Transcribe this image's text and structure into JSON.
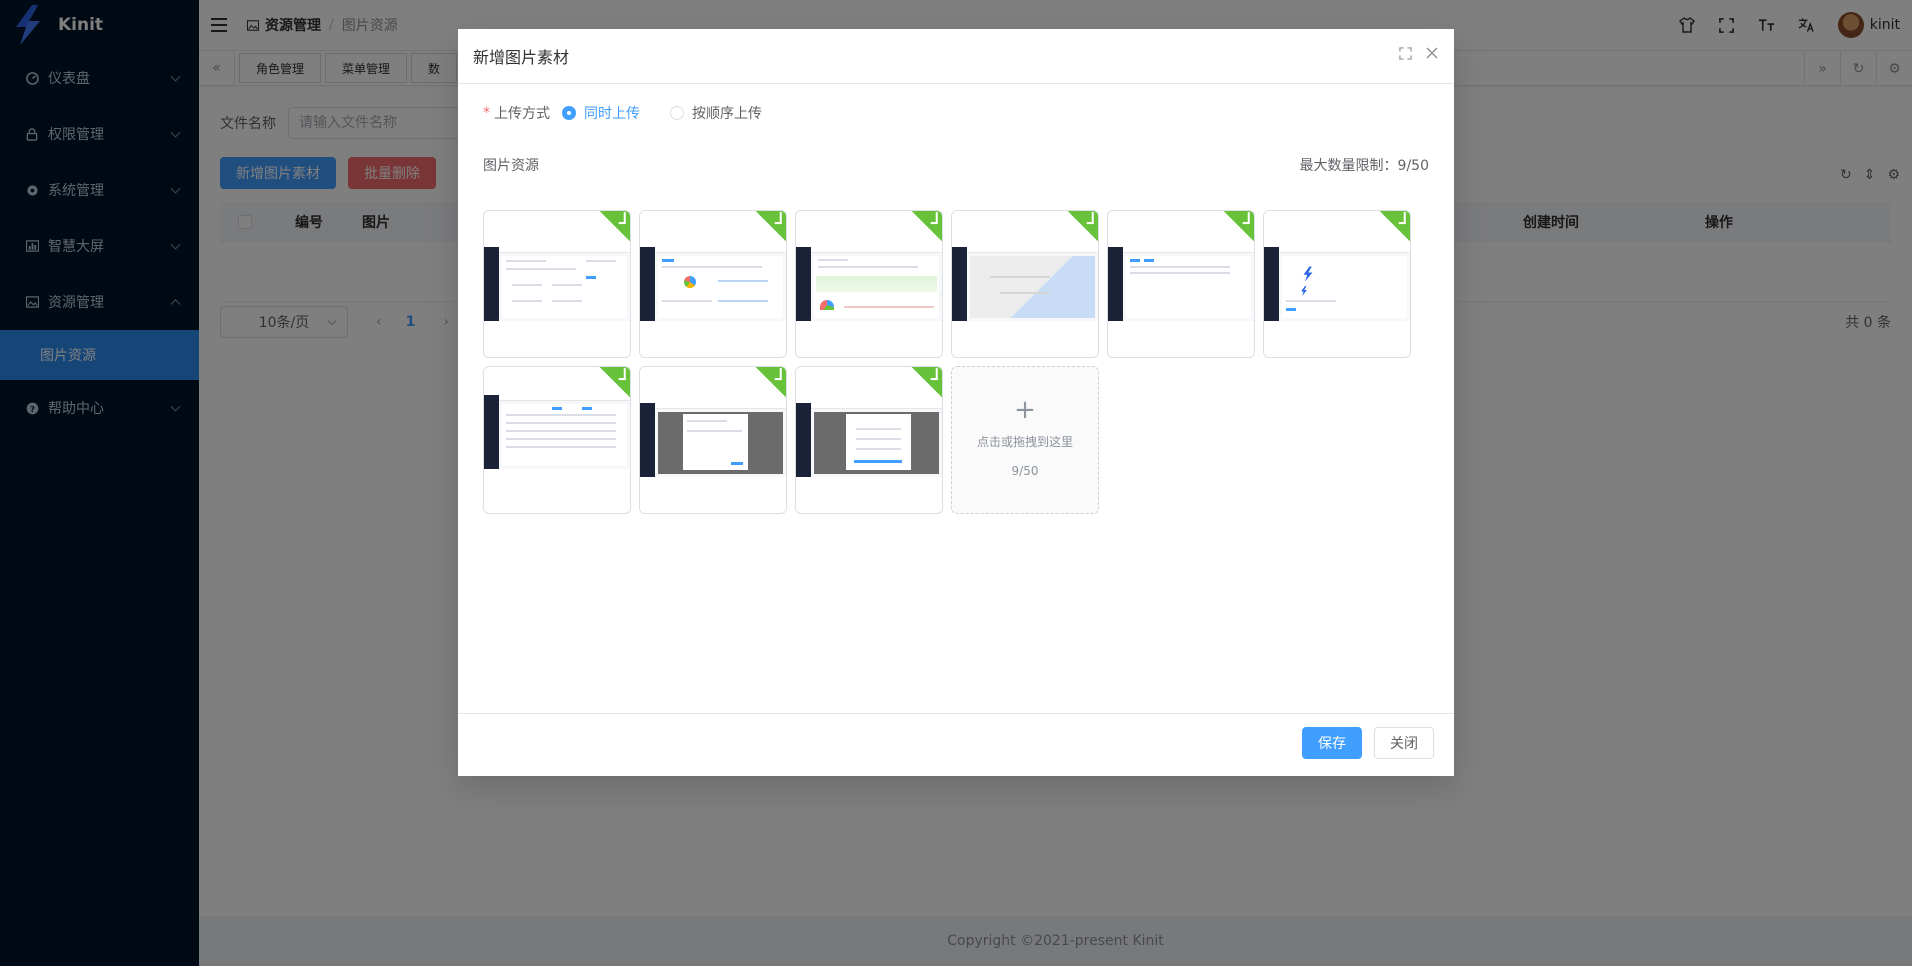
{
  "app": {
    "name": "Kinit"
  },
  "sidebar": {
    "items": [
      {
        "label": "仪表盘",
        "icon": "dashboard-icon"
      },
      {
        "label": "权限管理",
        "icon": "lock-icon"
      },
      {
        "label": "系统管理",
        "icon": "gear-icon"
      },
      {
        "label": "智慧大屏",
        "icon": "chart-icon"
      },
      {
        "label": "资源管理",
        "icon": "image-icon",
        "expanded": true
      },
      {
        "label": "帮助中心",
        "icon": "help-icon"
      }
    ],
    "sub_item": "图片资源"
  },
  "header": {
    "breadcrumb": [
      "资源管理",
      "图片资源"
    ],
    "separator": "/",
    "username": "kinit"
  },
  "tags": [
    "角色管理",
    "菜单管理",
    "数"
  ],
  "search": {
    "label": "文件名称",
    "placeholder": "请输入文件名称"
  },
  "toolbar": {
    "add_label": "新增图片素材",
    "batch_delete_label": "批量删除"
  },
  "table": {
    "columns": [
      "编号",
      "图片",
      "创建时间",
      "操作"
    ]
  },
  "pagination": {
    "page_size": "10条/页",
    "current_page": "1",
    "total": "共 0 条"
  },
  "footer": {
    "copyright": "Copyright ©2021-present Kinit"
  },
  "dialog": {
    "title": "新增图片素材",
    "upload_method_label": "上传方式",
    "required_mark": "*",
    "options": [
      "同时上传",
      "按顺序上传"
    ],
    "selected_option": "同时上传",
    "image_section_label": "图片资源",
    "max_limit": "最大数量限制：9/50",
    "upload_hint": "点击或拖拽到这里",
    "upload_count": "9/50",
    "images_count": 9,
    "save_label": "保存",
    "close_label": "关闭"
  },
  "colors": {
    "sidebar_bg": "#001529",
    "active_menu": "#2d8cf0",
    "primary": "#409eff",
    "danger": "#f56c6c",
    "success": "#67c23a"
  }
}
